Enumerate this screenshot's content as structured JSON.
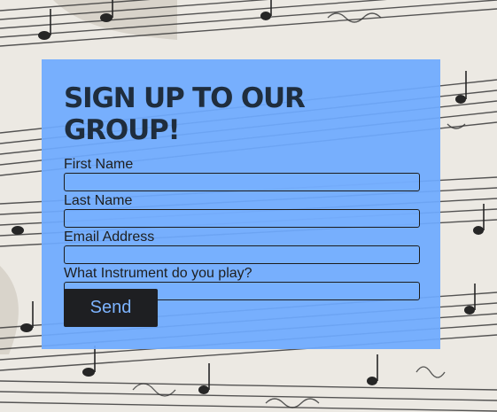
{
  "form": {
    "title": "SIGN UP TO OUR GROUP!",
    "fields": [
      {
        "label": "First Name",
        "value": ""
      },
      {
        "label": "Last Name",
        "value": ""
      },
      {
        "label": "Email Address",
        "value": ""
      },
      {
        "label": "What Instrument do you play?",
        "value": ""
      }
    ],
    "submit_label": "Send"
  },
  "colors": {
    "panel": "#6eaaff",
    "title": "#1f2d3d",
    "button_bg": "#1e1f22",
    "button_text": "#7db4ff"
  }
}
